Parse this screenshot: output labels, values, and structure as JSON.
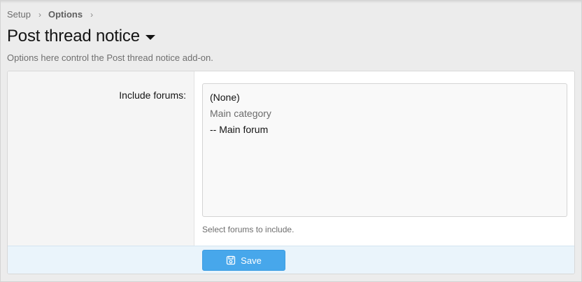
{
  "breadcrumb": {
    "items": [
      "Setup",
      "Options"
    ],
    "separator": "›"
  },
  "page": {
    "title": "Post thread notice",
    "description": "Options here control the Post thread notice add-on."
  },
  "form": {
    "field_label": "Include forums:",
    "options": [
      {
        "label": "(None)",
        "type": "option"
      },
      {
        "label": "Main category",
        "type": "group"
      },
      {
        "label": "-- Main forum",
        "type": "option"
      }
    ],
    "hint": "Select forums to include."
  },
  "footer": {
    "save_label": "Save"
  },
  "colors": {
    "accent": "#47a7eb",
    "footer_bg": "#eaf4fb",
    "page_bg": "#ececec"
  },
  "icons": {
    "title_menu": "caret-down-icon",
    "save": "floppy-disk-icon"
  }
}
